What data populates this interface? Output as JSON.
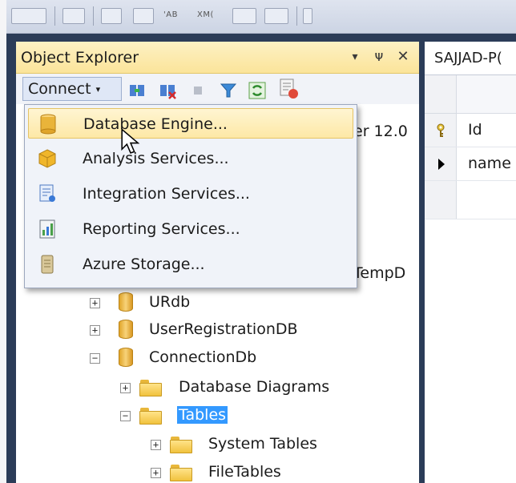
{
  "toolbar": {
    "ab_label": "'AB",
    "xml_label": "XM("
  },
  "object_explorer": {
    "title": "Object Explorer",
    "header_buttons": {
      "dropdown": "▾",
      "pin": "ᴪ",
      "close": "✕"
    },
    "connect_label": "Connect",
    "connect_caret": "▾",
    "peek": {
      "server_suffix": "er 12.0",
      "tempdb_suffix": "TempD"
    },
    "tree": {
      "urdb": "URdb",
      "userregistration": "UserRegistrationDB",
      "connectiondb": "ConnectionDb",
      "database_diagrams": "Database Diagrams",
      "tables": "Tables",
      "system_tables": "System Tables",
      "filetables": "FileTables"
    }
  },
  "connect_menu": {
    "items": [
      {
        "label": "Database Engine...",
        "icon": "database-engine-icon"
      },
      {
        "label": "Analysis Services...",
        "icon": "analysis-services-icon"
      },
      {
        "label": "Integration Services...",
        "icon": "integration-services-icon"
      },
      {
        "label": "Reporting Services...",
        "icon": "reporting-services-icon"
      },
      {
        "label": "Azure Storage...",
        "icon": "azure-storage-icon"
      }
    ]
  },
  "designer": {
    "tab_label": "SAJJAD-P(",
    "rows": [
      {
        "column": "Id",
        "marker": "primary-key-icon"
      },
      {
        "column": "name",
        "marker": "row-pointer-icon"
      }
    ]
  },
  "colors": {
    "frame": "#2b3c58",
    "header": "#fbe49a",
    "selection": "#3399ff",
    "menu_highlight": "#fde8a6"
  }
}
